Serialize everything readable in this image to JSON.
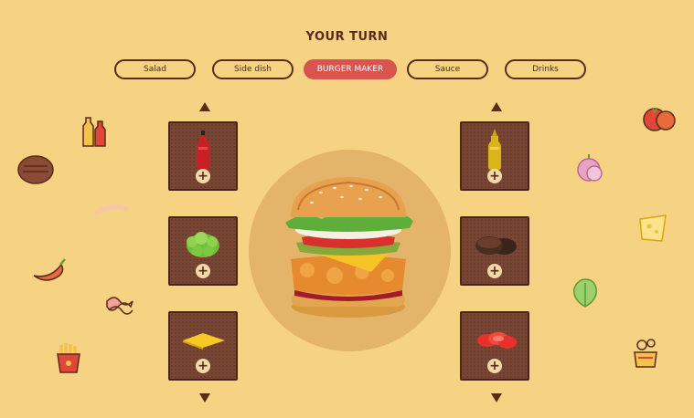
{
  "header": {
    "title": "YOUR TURN"
  },
  "tabs": [
    {
      "label": "Salad",
      "active": false
    },
    {
      "label": "Side dish",
      "active": false
    },
    {
      "label": "BURGER MAKER",
      "active": true
    },
    {
      "label": "Sauce",
      "active": false
    },
    {
      "label": "Drinks",
      "active": false
    }
  ],
  "left_column": [
    "ketchup-bottle",
    "lettuce",
    "cheese-slice"
  ],
  "right_column": [
    "mustard-bottle",
    "beef-patties",
    "tomato-slices"
  ],
  "add_symbol": "+",
  "colors": {
    "background": "#f6d283",
    "accent": "#d9534f",
    "card": "#7a4634",
    "text": "#5a2a1a"
  }
}
